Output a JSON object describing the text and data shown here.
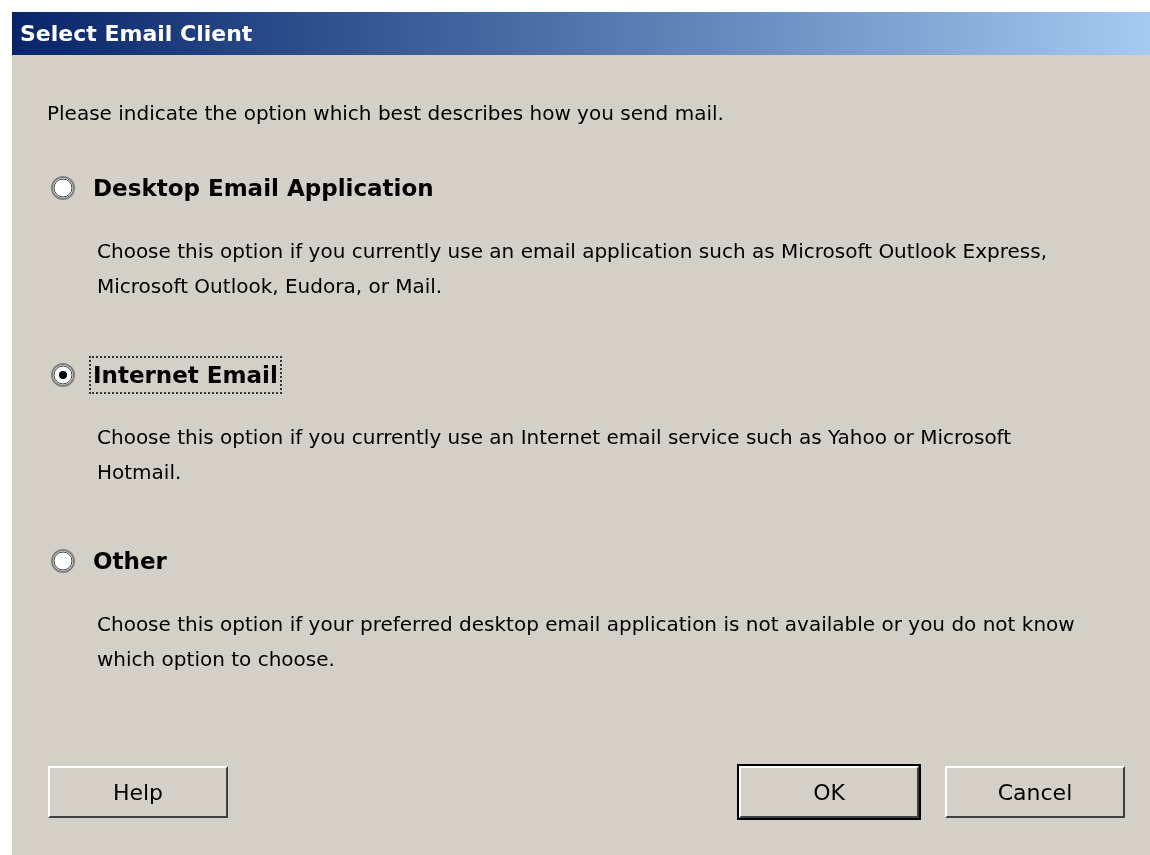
{
  "window": {
    "title": "Select Email Client"
  },
  "intro": "Please indicate the option which best describes how you send mail.",
  "options": [
    {
      "label": "Desktop Email Application",
      "selected": false,
      "description": "Choose this option if you currently use an email application such as Microsoft Outlook Express, Microsoft Outlook, Eudora, or Mail."
    },
    {
      "label": "Internet Email",
      "selected": true,
      "description": "Choose this option if you currently use an Internet email service such as Yahoo or Microsoft Hotmail."
    },
    {
      "label": "Other",
      "selected": false,
      "description": "Choose this option if your preferred desktop email application is not available or you do not know which option to choose."
    }
  ],
  "buttons": [
    {
      "label": "Help",
      "default": false
    },
    {
      "label": "OK",
      "default": true
    },
    {
      "label": "Cancel",
      "default": false
    }
  ]
}
